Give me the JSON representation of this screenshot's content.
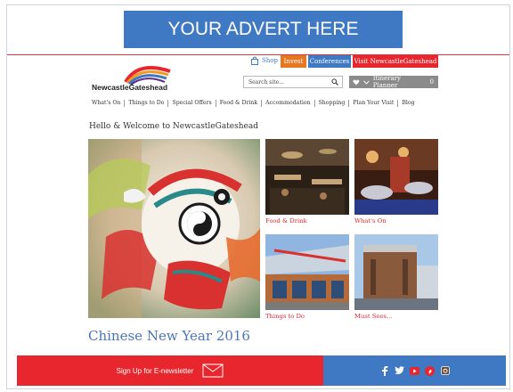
{
  "advert": {
    "text": "YOUR ADVERT HERE"
  },
  "brand": {
    "name": "NewcastleGateshead"
  },
  "topbar": {
    "shop_label": "Shop",
    "buttons": [
      {
        "label": "Invest",
        "color": "#e87722"
      },
      {
        "label": "Conferences",
        "color": "#3f78c3"
      },
      {
        "label": "Visit NewcastleGateshead",
        "color": "#e8262d"
      }
    ]
  },
  "search": {
    "placeholder": "Search site..."
  },
  "itinerary": {
    "label": "Itinerary Planner",
    "count": "0"
  },
  "nav": {
    "items": [
      "What's On",
      "Things to Do",
      "Special Offers",
      "Food & Drink",
      "Accommodation",
      "Shopping",
      "Plan Your Visit",
      "Blog"
    ]
  },
  "welcome": {
    "text": "Hello & Welcome to NewcastleGateshead"
  },
  "tiles": [
    {
      "caption": "Food & Drink"
    },
    {
      "caption": "What's On"
    },
    {
      "caption": "Things to Do"
    },
    {
      "caption": "Must Sees..."
    }
  ],
  "event": {
    "title": "Chinese New Year 2016"
  },
  "footer": {
    "signup_label": "Sign Up for E-newsletter",
    "social_icons": [
      "facebook-icon",
      "twitter-icon",
      "youtube-icon",
      "pinterest-icon",
      "instagram-icon"
    ]
  },
  "colors": {
    "accent_blue": "#3f78c3",
    "accent_red": "#e8262d",
    "accent_orange": "#e87722",
    "title_blue": "#4a76b8"
  }
}
